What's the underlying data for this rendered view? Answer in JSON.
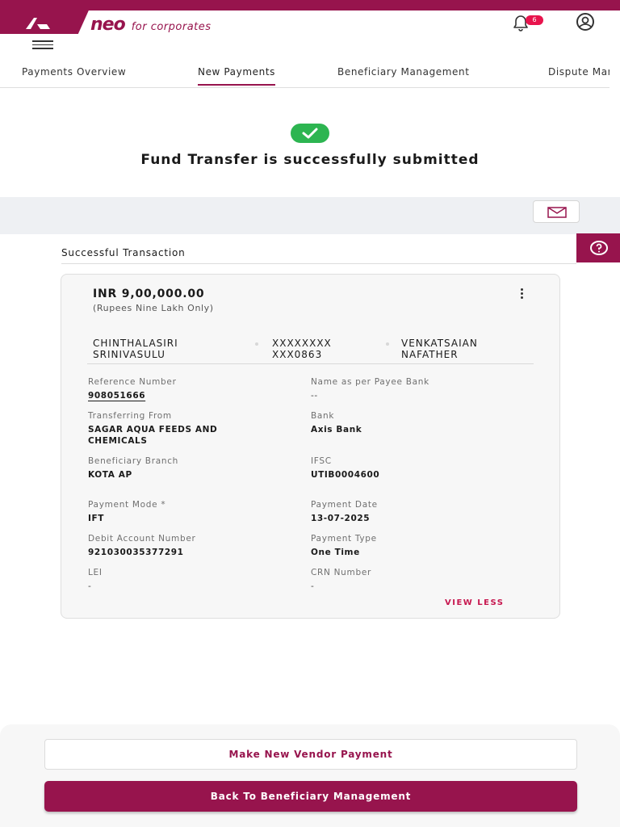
{
  "brand": {
    "name": "neo",
    "tagline": "for corporates",
    "accent": "#97144d"
  },
  "header": {
    "notification_icon": "bell-icon",
    "notification_count": "6",
    "profile_icon": "user-profile-icon",
    "menu_icon": "hamburger-menu-icon"
  },
  "tabs": [
    {
      "label": "Payments Overview"
    },
    {
      "label": "New Payments",
      "active": true
    },
    {
      "label": "Beneficiary Management"
    },
    {
      "label": "Dispute Management"
    }
  ],
  "status": {
    "icon": "success-check-icon",
    "title": "Fund Transfer is successfully submitted",
    "success_color": "#2db551"
  },
  "toolbar": {
    "mail_icon": "mail-icon"
  },
  "help": {
    "icon": "help-question-icon"
  },
  "section_title": "Successful Transaction",
  "transaction": {
    "amount": "INR 9,00,000.00",
    "amount_words": "(Rupees Nine Lakh Only)",
    "payer_name_line1": "CHINTHALASIRI",
    "payer_name_line2": "SRINIVASULU",
    "account_line1": "XXXXXXXX",
    "account_line2": "XXX0863",
    "payee_name_line1": "VENKATSAIAN",
    "payee_name_line2": "NAFATHER",
    "fields": {
      "reference_number": {
        "label": "Reference Number",
        "value": "908051666"
      },
      "name_as_per_payee_bank": {
        "label": "Name as per Payee Bank",
        "value": "--"
      },
      "transferring_from": {
        "label": "Transferring From",
        "value_line1": "SAGAR AQUA FEEDS AND",
        "value_line2": "CHEMICALS"
      },
      "bank": {
        "label": "Bank",
        "value": "Axis Bank"
      },
      "beneficiary_branch": {
        "label": "Beneficiary Branch",
        "value": "KOTA AP"
      },
      "ifsc": {
        "label": "IFSC",
        "value": "UTIB0004600"
      },
      "payment_mode": {
        "label": "Payment Mode *",
        "value": "IFT"
      },
      "payment_date": {
        "label": "Payment Date",
        "value": "13-07-2025"
      },
      "debit_account_number": {
        "label": "Debit Account Number",
        "value": "921030035377291"
      },
      "payment_type": {
        "label": "Payment Type",
        "value": "One Time"
      },
      "lei": {
        "label": "LEI",
        "value": "-"
      },
      "crn_number": {
        "label": "CRN Number",
        "value": "-"
      }
    },
    "view_less": "VIEW LESS"
  },
  "actions": {
    "make_new_payment": "Make New Vendor Payment",
    "back_to_beneficiary": "Back To Beneficiary Management"
  }
}
